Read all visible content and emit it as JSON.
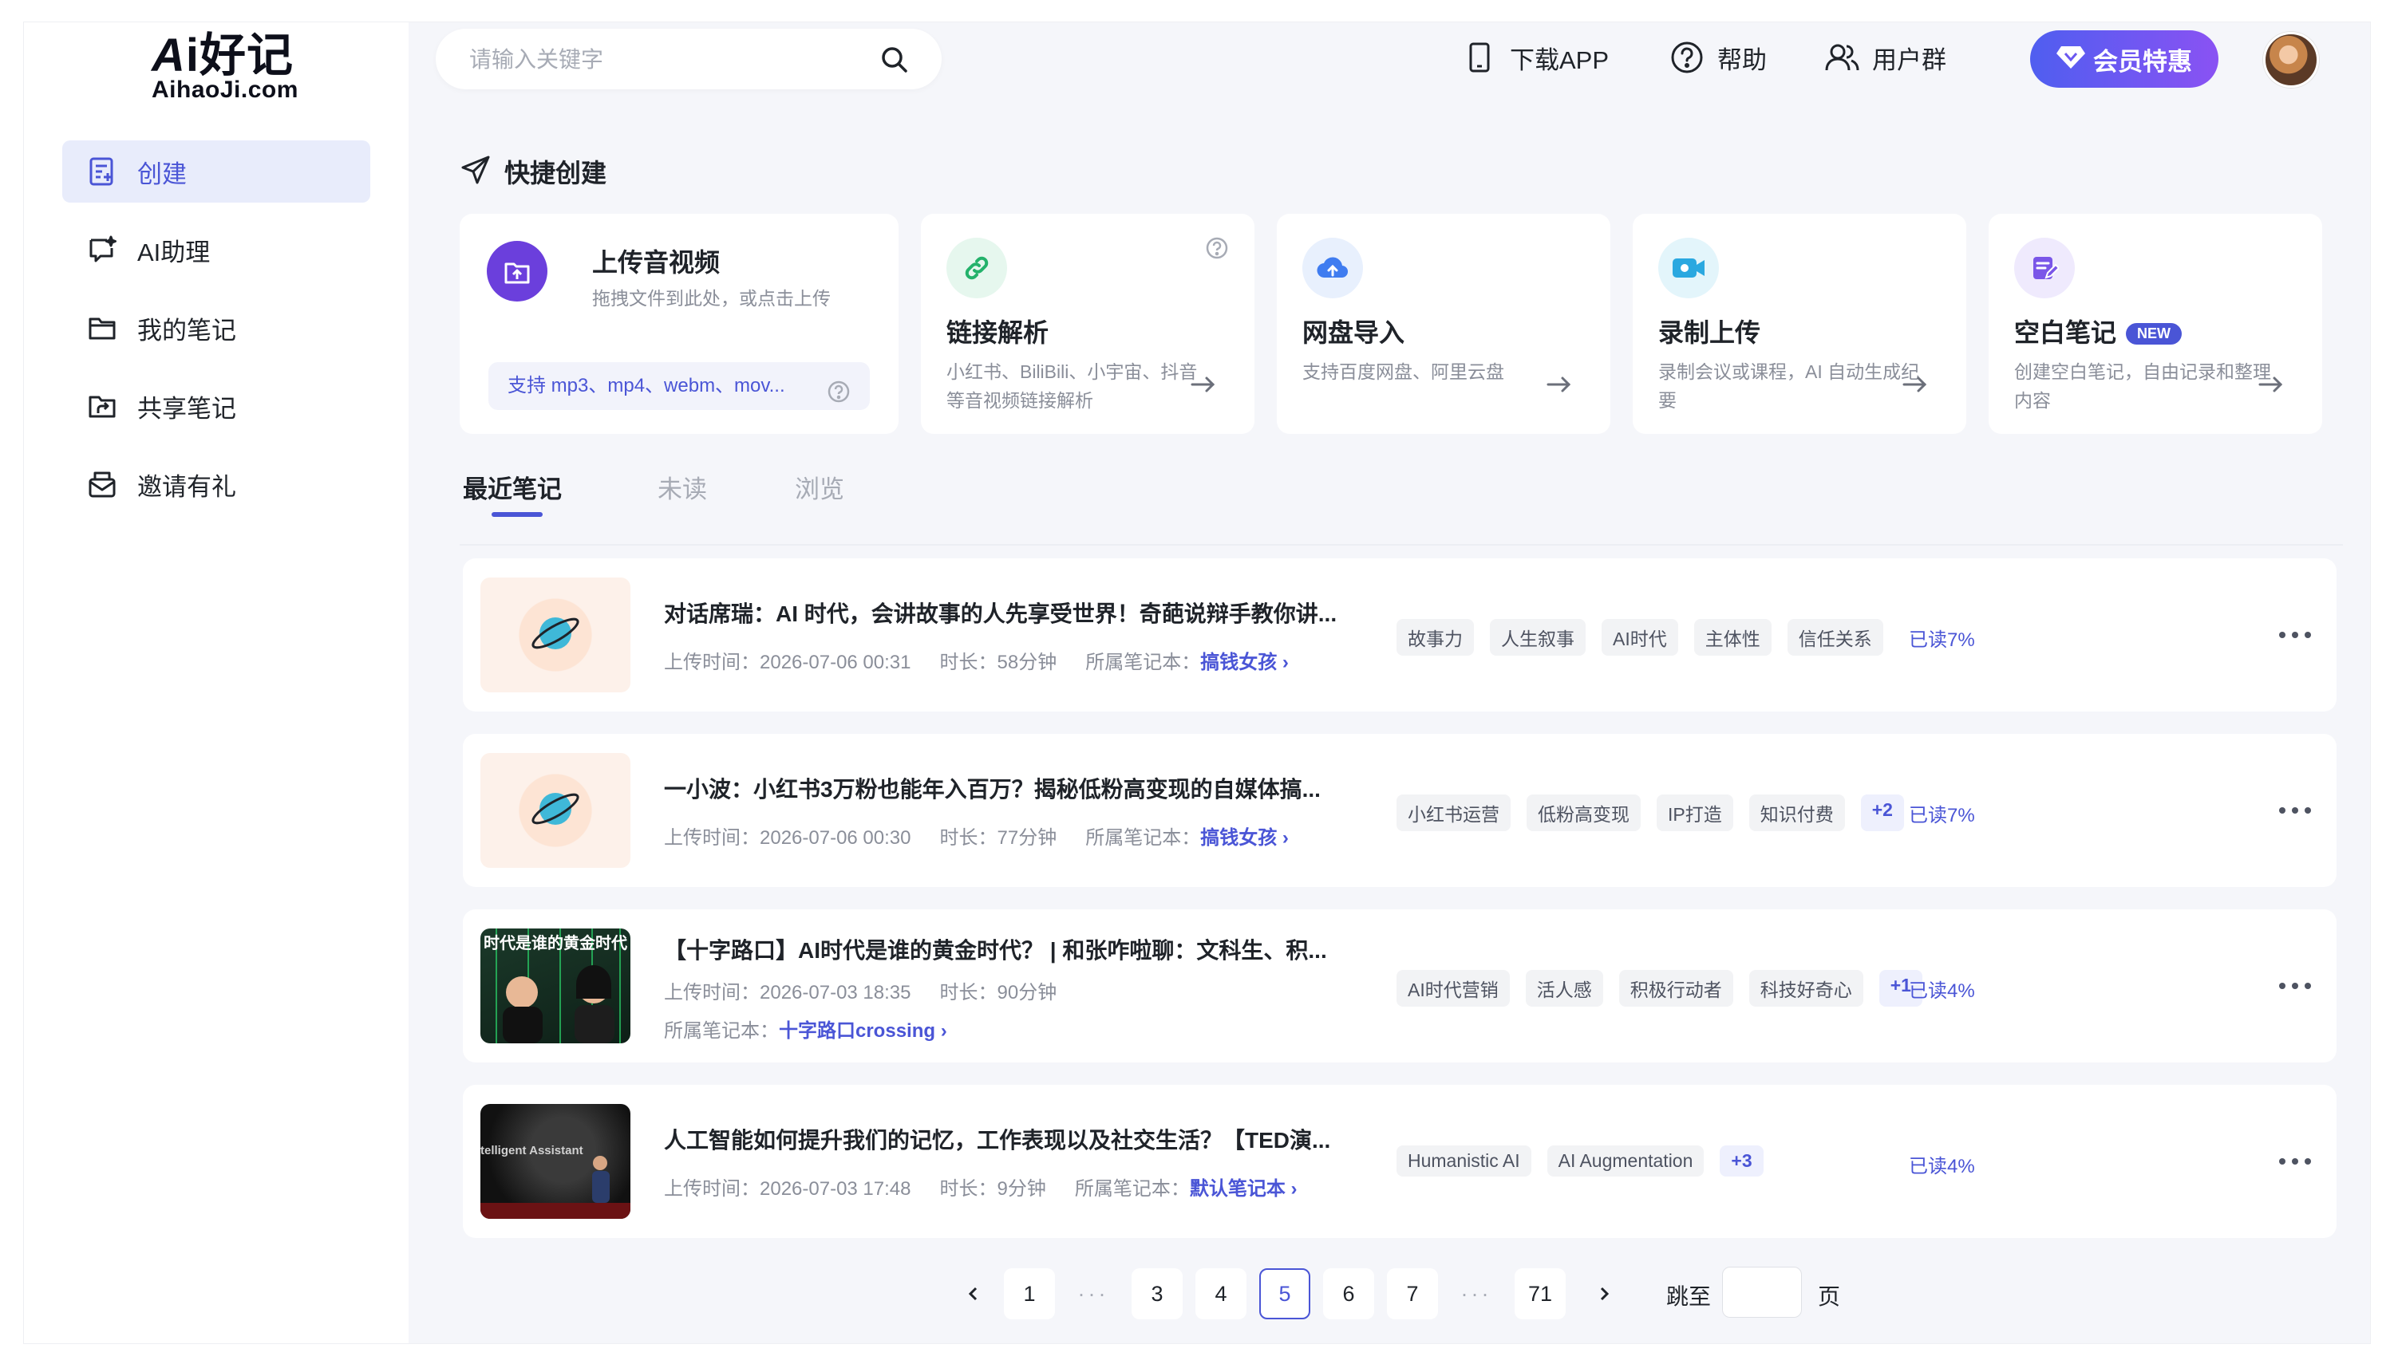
{
  "brand": {
    "logo_main_a": "A",
    "logo_main_i": "i",
    "logo_main_cn": "好记",
    "logo_sub": "AihaoJi.com"
  },
  "sidebar": {
    "items": [
      {
        "label": "创建",
        "icon": "create-note-icon",
        "active": true
      },
      {
        "label": "AI助理",
        "icon": "ai-chat-icon",
        "active": false
      },
      {
        "label": "我的笔记",
        "icon": "folder-icon",
        "active": false
      },
      {
        "label": "共享笔记",
        "icon": "shared-folder-icon",
        "active": false
      },
      {
        "label": "邀请有礼",
        "icon": "gift-mail-icon",
        "active": false
      }
    ]
  },
  "header": {
    "search_placeholder": "请输入关键字",
    "download_app": "下载APP",
    "help": "帮助",
    "user_group": "用户群",
    "vip": "会员特惠"
  },
  "quick_create": {
    "title": "快捷创建",
    "upload": {
      "title": "上传音视频",
      "desc": "拖拽文件到此处，或点击上传",
      "formats": "支持 mp3、mp4、webm、mov..."
    },
    "cards": [
      {
        "title": "链接解析",
        "desc": "小红书、BiliBili、小宇宙、抖音等音视频链接解析",
        "color": "#e6f7ee"
      },
      {
        "title": "网盘导入",
        "desc": "支持百度网盘、阿里云盘",
        "color": "#e8f0fd"
      },
      {
        "title": "录制上传",
        "desc": "录制会议或课程，AI 自动生成纪要",
        "color": "#e3f5fb"
      },
      {
        "title": "空白笔记",
        "badge": "NEW",
        "desc": "创建空白笔记，自由记录和整理内容",
        "color": "#efeafd"
      }
    ]
  },
  "tabs": [
    {
      "label": "最近笔记",
      "active": true
    },
    {
      "label": "未读",
      "active": false
    },
    {
      "label": "浏览",
      "active": false
    }
  ],
  "notes": [
    {
      "title": "对话席瑞：AI 时代，会讲故事的人先享受世界！奇葩说辩手教你讲...",
      "upload_label": "上传时间：",
      "upload_time": "2026-07-06 00:31",
      "duration_label": "时长：",
      "duration": "58分钟",
      "notebook_label": "所属笔记本：",
      "notebook": "搞钱女孩",
      "tags": [
        "故事力",
        "人生叙事",
        "AI时代",
        "主体性",
        "信任关系"
      ],
      "more": "",
      "read": "已读7%"
    },
    {
      "title": "一小波：小红书3万粉也能年入百万？揭秘低粉高变现的自媒体搞...",
      "upload_label": "上传时间：",
      "upload_time": "2026-07-06 00:30",
      "duration_label": "时长：",
      "duration": "77分钟",
      "notebook_label": "所属笔记本：",
      "notebook": "搞钱女孩",
      "tags": [
        "小红书运营",
        "低粉高变现",
        "IP打造",
        "知识付费"
      ],
      "more": "+2",
      "read": "已读7%"
    },
    {
      "title": "【十字路口】AI时代是谁的黄金时代？ | 和张咋啦聊：文科生、积...",
      "upload_label": "上传时间：",
      "upload_time": "2026-07-03 18:35",
      "duration_label": "时长：",
      "duration": "90分钟",
      "notebook_label": "所属笔记本：",
      "notebook": "十字路口crossing",
      "tags": [
        "AI时代营销",
        "活人感",
        "积极行动者",
        "科技好奇心"
      ],
      "more": "+1",
      "read": "已读4%",
      "thumb_text": "时代是谁的黄金时代"
    },
    {
      "title": "人工智能如何提升我们的记忆，工作表现以及社交生活？【TED演...",
      "upload_label": "上传时间：",
      "upload_time": "2026-07-03 17:48",
      "duration_label": "时长：",
      "duration": "9分钟",
      "notebook_label": "所属笔记本：",
      "notebook": "默认笔记本",
      "tags": [
        "Humanistic AI",
        "AI Augmentation"
      ],
      "more": "+3",
      "read": "已读4%",
      "thumb_text": "telligent Assistant"
    }
  ],
  "pagination": {
    "pages": [
      "1",
      "3",
      "4",
      "5",
      "6",
      "7",
      "71"
    ],
    "current": "5",
    "ellipsis": "···",
    "jump_label": "跳至",
    "page_label": "页"
  },
  "colors": {
    "accent": "#4a55d6",
    "vip_start": "#4f5ef0",
    "vip_end": "#8a52f3",
    "background": "#f5f6fa"
  }
}
